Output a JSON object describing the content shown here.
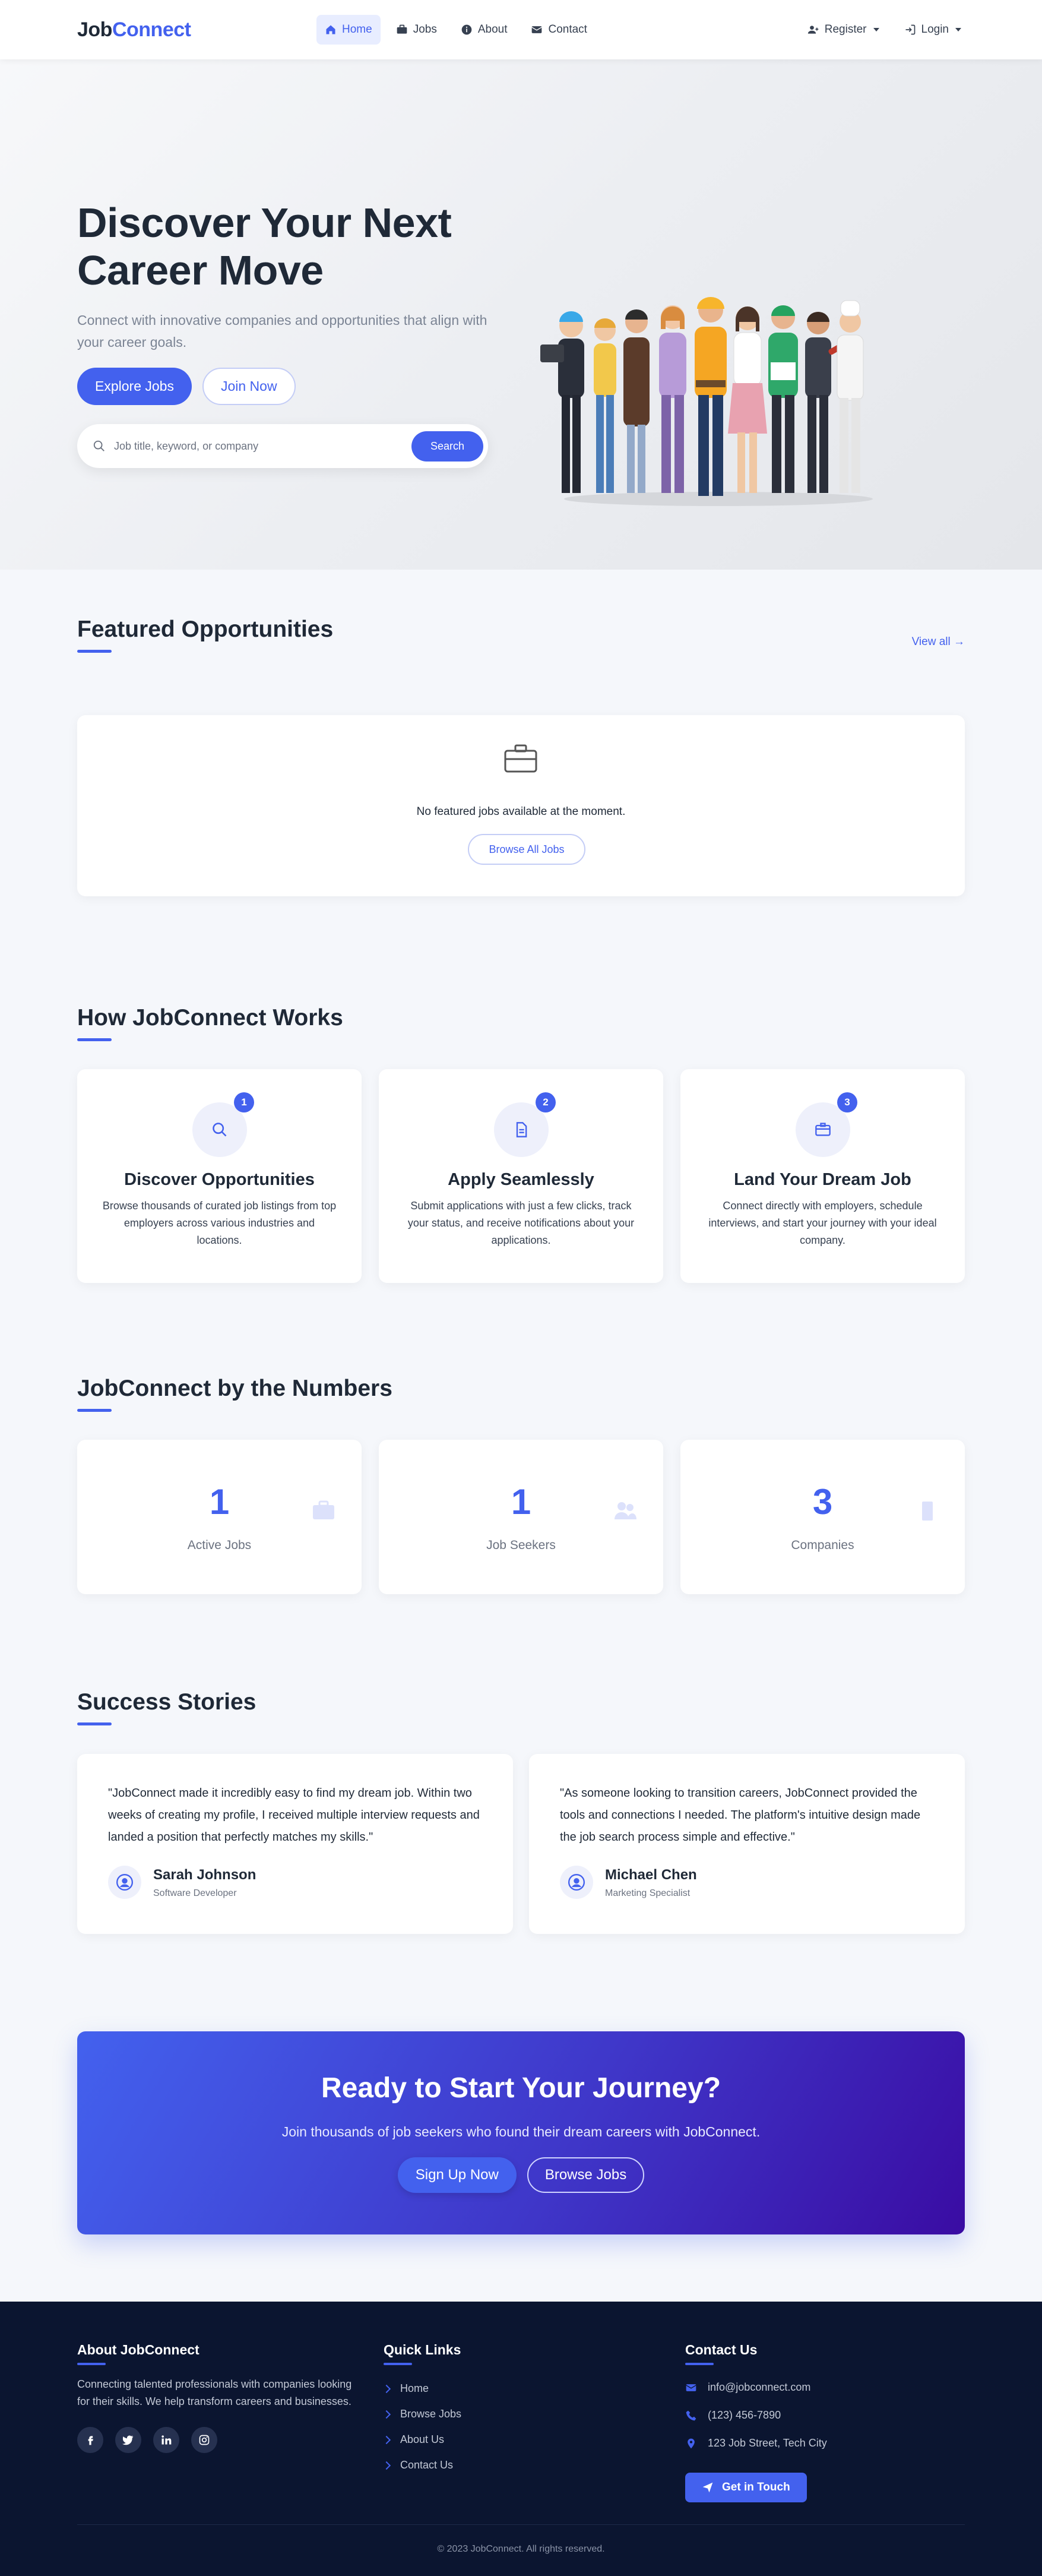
{
  "brand": {
    "part1": "Job",
    "part2": "Connect"
  },
  "nav": {
    "links": [
      {
        "label": "Home",
        "icon": "home-icon"
      },
      {
        "label": "Jobs",
        "icon": "briefcase-icon"
      },
      {
        "label": "About",
        "icon": "info-icon"
      },
      {
        "label": "Contact",
        "icon": "envelope-icon"
      }
    ],
    "active": "Home",
    "register": "Register",
    "login": "Login"
  },
  "hero": {
    "title_line1": "Discover Your Next",
    "title_line2": "Career Move",
    "subtitle": "Connect with innovative companies and opportunities that align with your career goals.",
    "explore_btn": "Explore Jobs",
    "join_btn": "Join Now",
    "search_placeholder": "Job title, keyword, or company",
    "search_btn": "Search"
  },
  "featured": {
    "title": "Featured Opportunities",
    "view_all": "View all →",
    "empty_message": "No featured jobs available at the moment.",
    "browse_btn": "Browse All Jobs"
  },
  "how": {
    "title": "How JobConnect Works",
    "steps": [
      {
        "num": "1",
        "title": "Discover Opportunities",
        "desc": "Browse thousands of curated job listings from top employers across various industries and locations.",
        "icon": "search-icon"
      },
      {
        "num": "2",
        "title": "Apply Seamlessly",
        "desc": "Submit applications with just a few clicks, track your status, and receive notifications about your applications.",
        "icon": "document-icon"
      },
      {
        "num": "3",
        "title": "Land Your Dream Job",
        "desc": "Connect directly with employers, schedule interviews, and start your journey with your ideal company.",
        "icon": "envelope-open-icon"
      }
    ]
  },
  "numbers": {
    "title": "JobConnect by the Numbers",
    "stats": [
      {
        "value": "1",
        "label": "Active Jobs",
        "icon": "briefcase-icon"
      },
      {
        "value": "1",
        "label": "Job Seekers",
        "icon": "users-icon"
      },
      {
        "value": "3",
        "label": "Companies",
        "icon": "building-icon"
      }
    ]
  },
  "stories": {
    "title": "Success Stories",
    "items": [
      {
        "quote": "\"JobConnect made it incredibly easy to find my dream job. Within two weeks of creating my profile, I received multiple interview requests and landed a position that perfectly matches my skills.\"",
        "name": "Sarah Johnson",
        "role": "Software Developer"
      },
      {
        "quote": "\"As someone looking to transition careers, JobConnect provided the tools and connections I needed. The platform's intuitive design made the job search process simple and effective.\"",
        "name": "Michael Chen",
        "role": "Marketing Specialist"
      }
    ]
  },
  "cta": {
    "title": "Ready to Start Your Journey?",
    "subtitle": "Join thousands of job seekers who found their dream careers with JobConnect.",
    "signup_btn": "Sign Up Now",
    "browse_btn": "Browse Jobs"
  },
  "footer": {
    "about_title": "About JobConnect",
    "about_text": "Connecting talented professionals with companies looking for their skills. We help transform careers and businesses.",
    "socials": [
      "facebook-icon",
      "twitter-icon",
      "linkedin-icon",
      "instagram-icon"
    ],
    "links_title": "Quick Links",
    "links": [
      "Home",
      "Browse Jobs",
      "About Us",
      "Contact Us"
    ],
    "contact_title": "Contact Us",
    "email": "info@jobconnect.com",
    "phone": "(123) 456-7890",
    "address": "123 Job Street, Tech City",
    "touch_btn": "Get in Touch",
    "copyright": "© 2023 JobConnect. All rights reserved."
  },
  "colors": {
    "accent": "#4361ee",
    "cta_end": "#3a0ca3",
    "footer_bg": "#0b1530"
  }
}
